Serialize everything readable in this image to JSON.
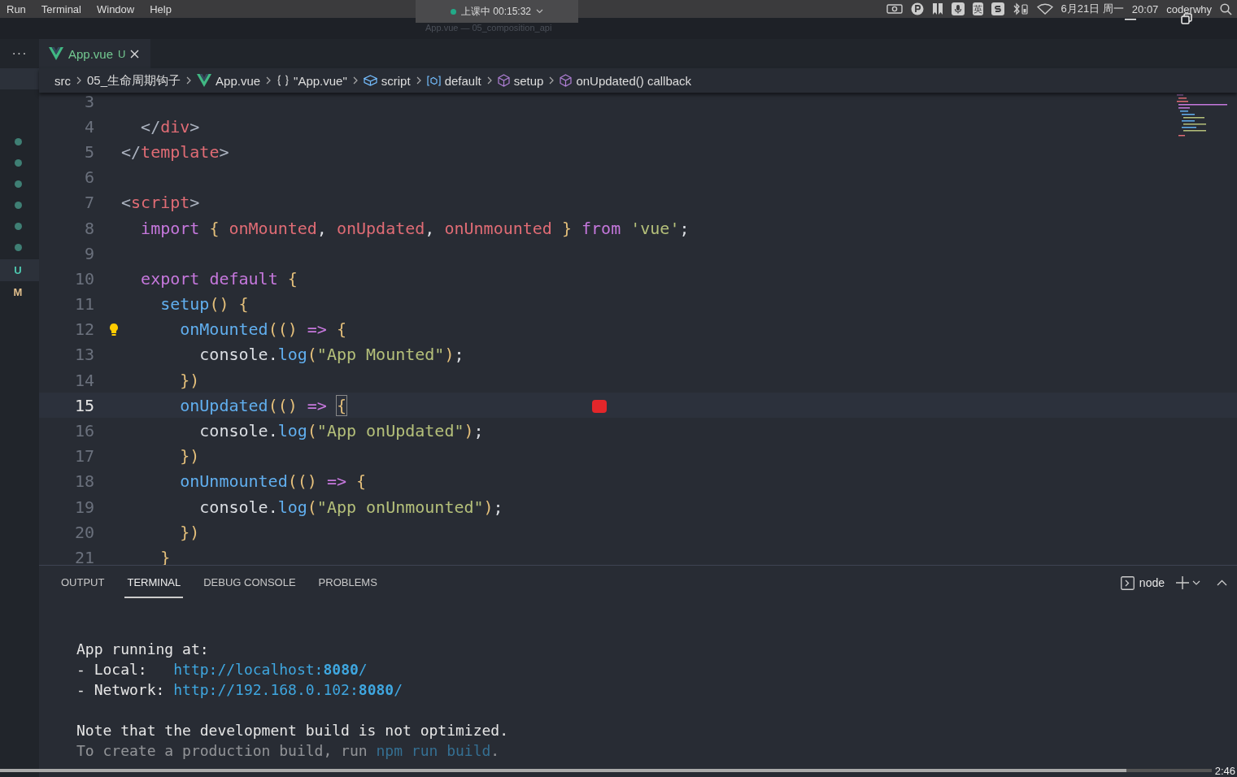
{
  "menu_bar": {
    "menus": [
      "Run",
      "Terminal",
      "Window",
      "Help"
    ],
    "session": "上课中 00:15:32",
    "ime": "英",
    "date": "6月21日 周一",
    "time": "20:07",
    "user": "coderwhy"
  },
  "window": {
    "title": "App.vue — 05_composition_api"
  },
  "more_button": "···",
  "sidebar": {
    "badges": [
      {
        "label": "U",
        "selected": true,
        "color": "#4ec9b0"
      },
      {
        "label": "M",
        "selected": false,
        "color": "#e2c08d"
      }
    ]
  },
  "tabs": [
    {
      "label": "App.vue",
      "status": "U",
      "selected": true
    }
  ],
  "breadcrumb": [
    {
      "kind": "text",
      "label": "src"
    },
    {
      "kind": "text",
      "label": "05_生命周期钩子"
    },
    {
      "kind": "vue",
      "label": "App.vue"
    },
    {
      "kind": "braces",
      "label": "\"App.vue\""
    },
    {
      "kind": "module",
      "label": "script"
    },
    {
      "kind": "variable",
      "label": "default"
    },
    {
      "kind": "method",
      "label": "setup"
    },
    {
      "kind": "method",
      "label": "onUpdated() callback"
    }
  ],
  "editor": {
    "lines": [
      {
        "number": "3",
        "current": false
      },
      {
        "number": "4",
        "current": false,
        "text": "  </div>"
      },
      {
        "number": "5",
        "current": false,
        "text": "</template>"
      },
      {
        "number": "6",
        "current": false
      },
      {
        "number": "7",
        "current": false,
        "text": "<script>"
      },
      {
        "number": "8",
        "current": false,
        "text": "  import { onMounted, onUpdated, onUnmounted } from 'vue';"
      },
      {
        "number": "9",
        "current": false
      },
      {
        "number": "10",
        "current": false,
        "text": "  export default {"
      },
      {
        "number": "11",
        "current": false,
        "text": "    setup() {"
      },
      {
        "number": "12",
        "current": false,
        "hint": true,
        "text": "      onMounted(() => {"
      },
      {
        "number": "13",
        "current": false,
        "text": "        console.log(\"App Mounted\");"
      },
      {
        "number": "14",
        "current": false,
        "text": "      })"
      },
      {
        "number": "15",
        "current": true,
        "text": "      onUpdated(() => {"
      },
      {
        "number": "16",
        "current": false,
        "text": "        console.log(\"App onUpdated\");"
      },
      {
        "number": "17",
        "current": false,
        "text": "      })"
      },
      {
        "number": "18",
        "current": false,
        "text": "      onUnmounted(() => {"
      },
      {
        "number": "19",
        "current": false,
        "text": "        console.log(\"App onUnmounted\");"
      },
      {
        "number": "20",
        "current": false,
        "text": "      })"
      },
      {
        "number": "21",
        "current": false,
        "text": "    }"
      }
    ]
  },
  "panel": {
    "tabs": [
      {
        "label": "OUTPUT",
        "selected": false
      },
      {
        "label": "TERMINAL",
        "selected": true
      },
      {
        "label": "DEBUG CONSOLE",
        "selected": false
      },
      {
        "label": "PROBLEMS",
        "selected": false
      }
    ],
    "shell": "node",
    "terminal": [
      [
        {
          "faded": false,
          "segments": [
            {
              "t": "App running at:",
              "link": false
            }
          ]
        },
        {
          "faded": false,
          "segments": [
            {
              "t": "- Local:   ",
              "link": false
            },
            {
              "t": "http://localhost:",
              "link": true
            },
            {
              "t": "8080",
              "link": true,
              "bold": true
            },
            {
              "t": "/",
              "link": true
            }
          ]
        },
        {
          "faded": false,
          "segments": [
            {
              "t": "- Network: ",
              "link": false
            },
            {
              "t": "http://192.168.0.102:",
              "link": true
            },
            {
              "t": "8080",
              "link": true,
              "bold": true
            },
            {
              "t": "/",
              "link": true
            }
          ]
        }
      ],
      [
        {
          "faded": false,
          "segments": [
            {
              "t": "Note that the development build is not optimized.",
              "link": false
            }
          ]
        },
        {
          "faded": true,
          "segments": [
            {
              "t": "To create a production build, run ",
              "link": false
            },
            {
              "t": "npm run build",
              "link": true
            },
            {
              "t": ".",
              "link": false
            }
          ]
        }
      ]
    ]
  },
  "video_player": {
    "progress": {
      "level": 0.93
    },
    "time": "2:46"
  }
}
